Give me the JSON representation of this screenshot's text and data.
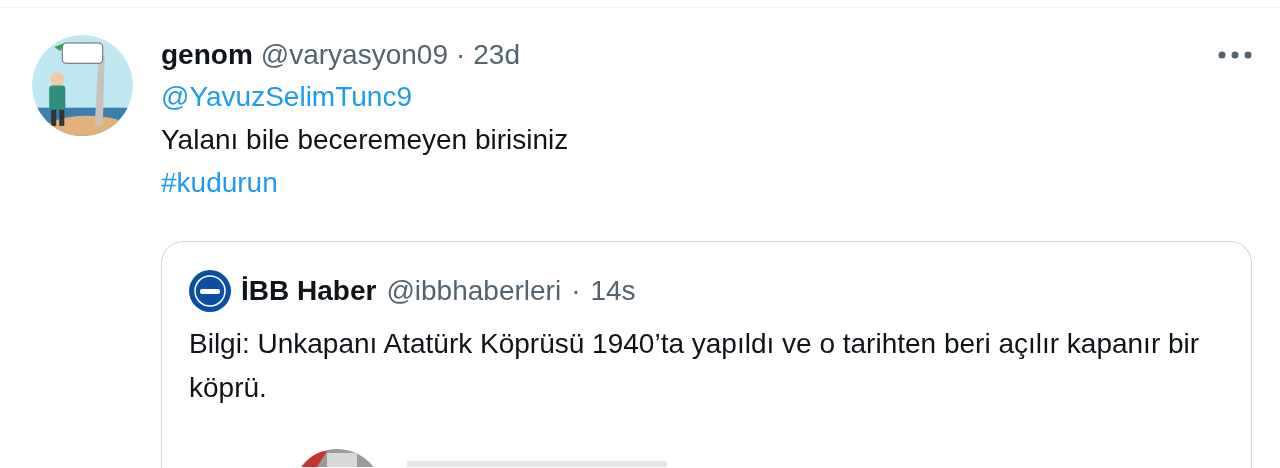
{
  "tweet": {
    "display_name": "genom",
    "handle": "@varyasyon09",
    "separator": "·",
    "time": "23d",
    "mention": "@YavuzSelimTunc9",
    "text": "Yalanı bile beceremeyen birisiniz",
    "hashtag": "#kudurun",
    "quote": {
      "display_name": "İBB Haber",
      "handle": "@ibbhaberleri",
      "separator": "·",
      "time": "14s",
      "text": "Bilgi: Unkapanı Atatürk Köprüsü 1940’ta yapıldı ve o tarihten beri açılır kapanır bir köprü."
    }
  }
}
